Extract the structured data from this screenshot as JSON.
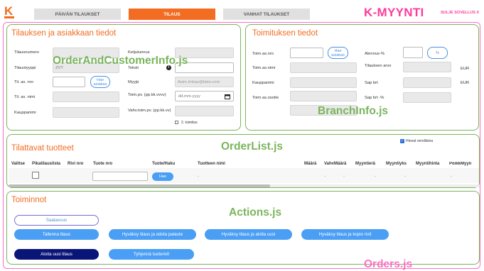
{
  "header": {
    "tabs": [
      {
        "label": "PÄIVÄN TILAUKSET"
      },
      {
        "label": "TILAUS"
      },
      {
        "label": "VANHAT TILAUKSET"
      }
    ],
    "logo_letter": "K",
    "brand": "K-MYYNTI",
    "close_label": "SULJE SOVELLUS X"
  },
  "orders_label": "Orders.js",
  "customer": {
    "title": "Tilauksen ja asiakkaan tiedot",
    "component_label": "OrderAndCustomerInfo.js",
    "tilausnumero": "Tilausnumero",
    "tilaustyyppi": "Tilaustyyppi",
    "tilaustyyppi_value": "ZVT",
    "til_as_nro": "Til. as. nro",
    "hae_asiakas": "Hae asiakas",
    "til_as_nimi": "Til. as. nimi",
    "kauppanimi": "Kauppanimi",
    "ketjutunnus": "Ketjutunnus",
    "teksti": "Teksti",
    "info_icon": "i",
    "myyja": "Myyjä",
    "myyja_value": "Asim.Imtiaz@tieto.com",
    "toim_pv": "Toim.pv. (pp.kk.vvvv)",
    "toim_pv_placeholder": "dd.mm.yyyy",
    "vahv_toim_pv": "Vahv.toim.pv. (pp.kk.vv)",
    "toinen_toimitus": "2. toimitus"
  },
  "branch": {
    "title": "Toimituksen tiedot",
    "component_label": "BranchInfo.js",
    "toim_as_nro": "Toim.as.nro",
    "hae_asiakas": "Hae asiakas",
    "toim_as_nimi": "Toim.as.nimi",
    "kauppanimi": "Kauppanimi",
    "toim_as_osoite": "Toim.as.osoite",
    "alennus": "Alennus-%",
    "percent": "%",
    "tilauksen_arvo": "Tilauksen arvo",
    "eur1": "EUR",
    "sap_brt": "Sap brt",
    "eur2": "EUR",
    "sap_brt_pct": "Sap brt -%"
  },
  "orderlist": {
    "title": "Tilattavat tuotteet",
    "component_label": "OrderList.js",
    "hinnat_verollisina": "Hinnat verollisina",
    "columns": {
      "valitse": "Valitse",
      "pikatilauslista": "Pikatilauslista",
      "rivi_nro": "Rivi nro",
      "tuote_nro": "Tuote nro",
      "tuote_haku": "Tuote/Haku",
      "tuotteen_nimi": "Tuotteen nimi",
      "maara": "Määrä",
      "vahv_maara": "VahvMäärä",
      "myyntiera": "Myyntierä",
      "myyntiyks": "Myyntiyks",
      "myyntihinta": "Myyntihinta",
      "poikk_myyn": "PoikkMyyn"
    },
    "row": {
      "hae": "Hae",
      "nimi": "-",
      "maara": "-",
      "vahv_maara": "-",
      "myyntiera": "-",
      "myyntiyks": "-",
      "myyntihinta": "-"
    }
  },
  "actions": {
    "title": "Toiminnot",
    "component_label": "Actions.js",
    "saatavuus": "Saatavuus",
    "tallenna": "Tallenna tilaus",
    "hyvaksy_odota": "Hyväksy tilaus ja odota palaute",
    "hyvaksy_aloita": "Hyväksy tilaus ja aloita uusi",
    "hyvaksy_kopio": "Hyväksy tilaus ja kopio rivit",
    "aloita_uusi": "Aloita uusi tilaus",
    "tyhjenna": "Tyhjennä tuoterivit"
  },
  "colors": {
    "accent": "#f26d21",
    "component": "#7ab55c",
    "brand": "#ff3b9a",
    "button": "#4a9ff5",
    "button_dark": "#0a1578"
  }
}
